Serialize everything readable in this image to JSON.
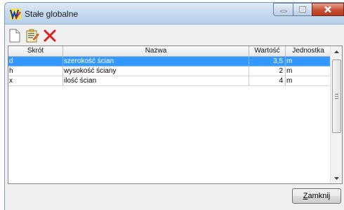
{
  "window": {
    "title": "Stałe globalne",
    "controls": {
      "minimize_icon": "minimize-icon",
      "maximize_icon": "maximize-icon",
      "close_icon": "close-x-icon"
    }
  },
  "toolbar": {
    "buttons": [
      {
        "icon": "new-document-icon"
      },
      {
        "icon": "edit-document-icon"
      },
      {
        "icon": "delete-x-icon",
        "color": "#e11d1d"
      }
    ]
  },
  "table": {
    "columns": [
      "Skrót",
      "Nazwa",
      "Wartość",
      "Jednostka"
    ],
    "rows": [
      {
        "skrot": "d",
        "nazwa": "szerokość ścian",
        "wartosc": "3,5",
        "jednostka": "m",
        "selected": true
      },
      {
        "skrot": "h",
        "nazwa": "wysokość ściany",
        "wartosc": "2",
        "jednostka": "m",
        "selected": false
      },
      {
        "skrot": "x",
        "nazwa": "ilość ścian",
        "wartosc": "4",
        "jednostka": "m",
        "selected": false
      }
    ]
  },
  "footer": {
    "close_label_underlined": "Z",
    "close_label_rest": "amknij"
  },
  "colors": {
    "selection": "#3399ff",
    "titlebar": "#c7dbf0"
  }
}
